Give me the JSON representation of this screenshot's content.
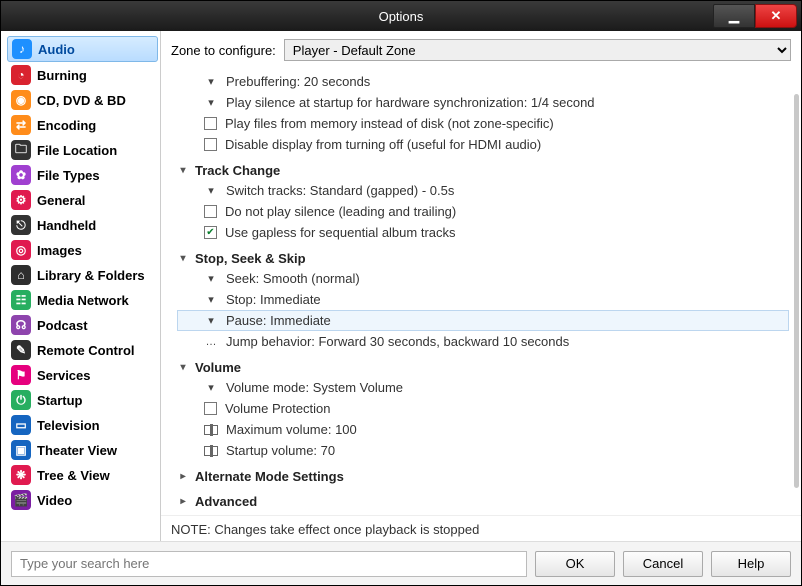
{
  "window": {
    "title": "Options"
  },
  "sidebar": {
    "items": [
      {
        "label": "Audio",
        "color": "#1e90ff",
        "glyph": "♪",
        "selected": true
      },
      {
        "label": "Burning",
        "color": "#d9232f",
        "glyph": "◔"
      },
      {
        "label": "CD, DVD & BD",
        "color": "#ff8c1a",
        "glyph": "◉"
      },
      {
        "label": "Encoding",
        "color": "#ff8c1a",
        "glyph": "⇄"
      },
      {
        "label": "File Location",
        "color": "#333333",
        "glyph": "🗀"
      },
      {
        "label": "File Types",
        "color": "#a040d0",
        "glyph": "✿"
      },
      {
        "label": "General",
        "color": "#e01a4f",
        "glyph": "⚙"
      },
      {
        "label": "Handheld",
        "color": "#333333",
        "glyph": "⎋"
      },
      {
        "label": "Images",
        "color": "#e01a4f",
        "glyph": "◎"
      },
      {
        "label": "Library & Folders",
        "color": "#2e2e2e",
        "glyph": "⌂"
      },
      {
        "label": "Media Network",
        "color": "#27ae60",
        "glyph": "☷"
      },
      {
        "label": "Podcast",
        "color": "#8e44ad",
        "glyph": "☊"
      },
      {
        "label": "Remote Control",
        "color": "#2e2e2e",
        "glyph": "✎"
      },
      {
        "label": "Services",
        "color": "#e6007e",
        "glyph": "⚑"
      },
      {
        "label": "Startup",
        "color": "#27ae60",
        "glyph": "⏻"
      },
      {
        "label": "Television",
        "color": "#1565c0",
        "glyph": "▭"
      },
      {
        "label": "Theater View",
        "color": "#1565c0",
        "glyph": "▣"
      },
      {
        "label": "Tree & View",
        "color": "#e01a4f",
        "glyph": "❋"
      },
      {
        "label": "Video",
        "color": "#7b1fa2",
        "glyph": "🎬"
      }
    ]
  },
  "zone": {
    "label": "Zone to configure:",
    "selected": "Player - Default Zone"
  },
  "settings": {
    "top_items": [
      {
        "type": "drop",
        "label": "Prebuffering: 20 seconds"
      },
      {
        "type": "drop",
        "label": "Play silence at startup for hardware synchronization: 1/4 second"
      },
      {
        "type": "check",
        "checked": false,
        "label": "Play files from memory instead of disk (not zone-specific)"
      },
      {
        "type": "check",
        "checked": false,
        "label": "Disable display from turning off (useful for HDMI audio)"
      }
    ],
    "groups": [
      {
        "title": "Track Change",
        "expanded": true,
        "items": [
          {
            "type": "drop",
            "label": "Switch tracks: Standard (gapped) - 0.5s"
          },
          {
            "type": "check",
            "checked": false,
            "label": "Do not play silence (leading and trailing)"
          },
          {
            "type": "check",
            "checked": true,
            "label": "Use gapless for sequential album tracks"
          }
        ]
      },
      {
        "title": "Stop, Seek & Skip",
        "expanded": true,
        "items": [
          {
            "type": "drop",
            "label": "Seek: Smooth (normal)"
          },
          {
            "type": "drop",
            "label": "Stop: Immediate"
          },
          {
            "type": "drop",
            "label": "Pause: Immediate",
            "hl": true
          },
          {
            "type": "more",
            "label": "Jump behavior: Forward 30 seconds, backward 10 seconds"
          }
        ]
      },
      {
        "title": "Volume",
        "expanded": true,
        "items": [
          {
            "type": "drop",
            "label": "Volume mode: System Volume"
          },
          {
            "type": "check",
            "checked": false,
            "label": "Volume Protection"
          },
          {
            "type": "slider",
            "label": "Maximum volume: 100"
          },
          {
            "type": "slider",
            "label": "Startup volume: 70"
          }
        ]
      },
      {
        "title": "Alternate Mode Settings",
        "expanded": false,
        "items": []
      },
      {
        "title": "Advanced",
        "expanded": false,
        "items": []
      }
    ]
  },
  "note": "NOTE: Changes take effect once playback is stopped",
  "footer": {
    "search_placeholder": "Type your search here",
    "ok": "OK",
    "cancel": "Cancel",
    "help": "Help"
  }
}
